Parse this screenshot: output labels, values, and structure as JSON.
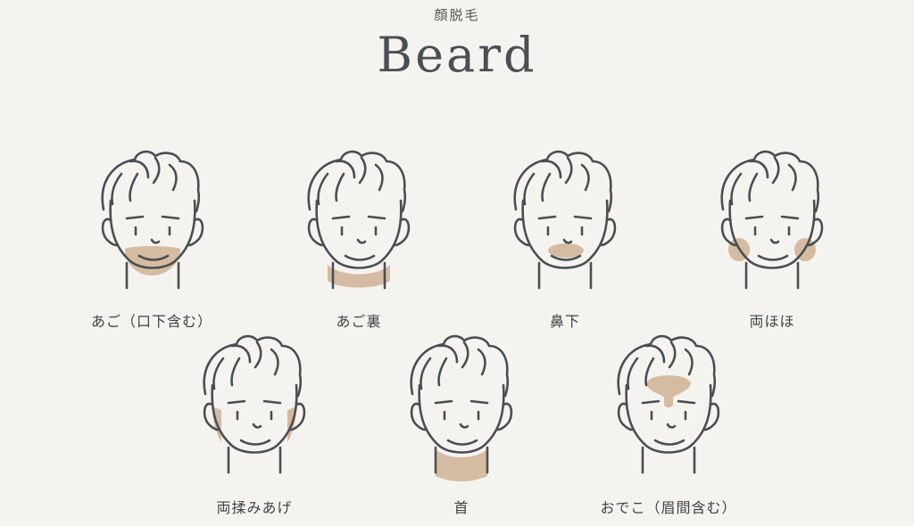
{
  "header": {
    "subtitle": "顔脱毛",
    "title": "Beard"
  },
  "items": [
    {
      "label": "あご（口下含む）"
    },
    {
      "label": "あご裏"
    },
    {
      "label": "鼻下"
    },
    {
      "label": "両ほほ"
    },
    {
      "label": "両揉みあげ"
    },
    {
      "label": "首"
    },
    {
      "label": "おでこ（眉間含む）"
    }
  ],
  "colors": {
    "background": "#f5f3f0",
    "highlight": "#d5bba1",
    "line": "#4a4e52"
  }
}
